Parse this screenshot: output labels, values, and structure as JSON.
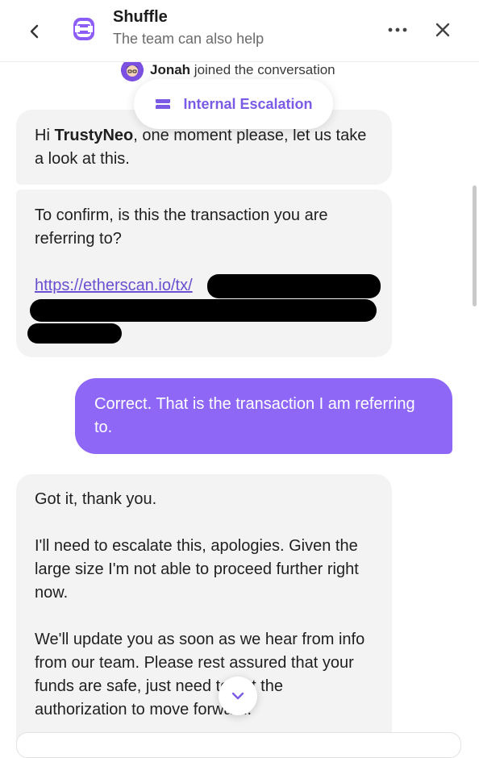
{
  "header": {
    "title": "Shuffle",
    "subtitle": "The team can also help",
    "icons": {
      "back": "chevron-left-icon",
      "logo": "shuffle-logo-icon",
      "more": "more-horizontal-icon",
      "close": "close-icon"
    },
    "accent_color": "#7b5be5"
  },
  "notice": {
    "name": "Jonah",
    "text": " joined the conversation"
  },
  "escalation": {
    "label": "Internal Escalation",
    "icon": "ticket-icon"
  },
  "messages": [
    {
      "from": "agent",
      "greeting": "Hi ",
      "username": "TrustyNeo",
      "rest": ", one moment please, let us take a look at this."
    },
    {
      "from": "agent",
      "text": "To confirm, is this the transaction you are referring to?",
      "link": "https://etherscan.io/tx/"
    },
    {
      "from": "user",
      "text": "Correct. That is the transaction I am referring to.",
      "color": "#8e67f6"
    },
    {
      "from": "agent",
      "p1": "Got it, thank you.",
      "p2": "I'll need to escalate this, apologies. Given the large size I'm not able to proceed further right now.",
      "p3": "We'll update you as soon as we hear from info from our team. Please rest assured that your funds are safe, just need to get the authorization to move forward."
    }
  ],
  "scroll_down": {
    "icon": "chevron-down-icon"
  }
}
